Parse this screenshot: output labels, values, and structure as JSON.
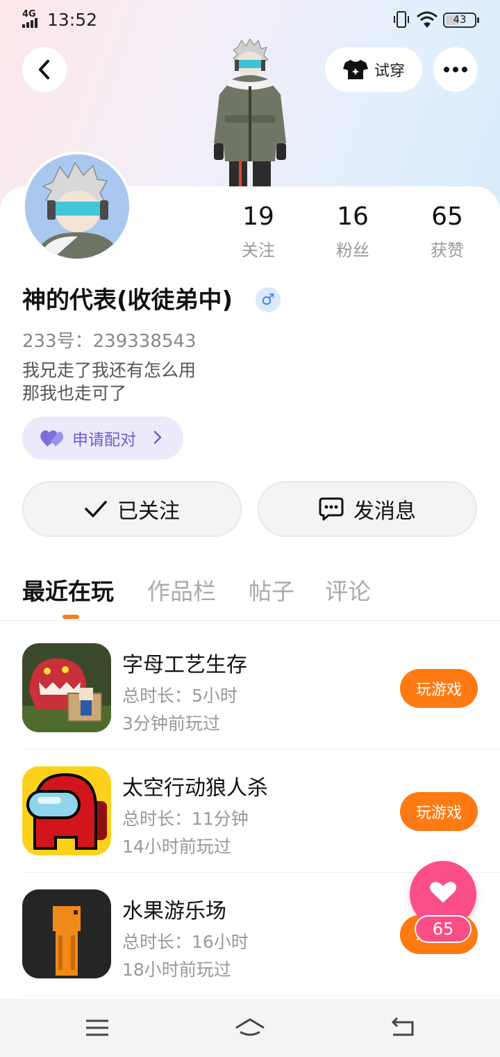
{
  "status_bar": {
    "network": "4G",
    "time": "13:52",
    "battery": "43"
  },
  "header": {
    "try_on_label": "试穿"
  },
  "profile": {
    "stats": [
      {
        "value": "19",
        "label": "关注"
      },
      {
        "value": "16",
        "label": "粉丝"
      },
      {
        "value": "65",
        "label": "获赞"
      }
    ],
    "name": "神的代表(收徒弟中)",
    "gender_symbol": "♂",
    "id_text": "233号：239338543",
    "bio_line1": "我兄走了我还有怎么用",
    "bio_line2": "那我也走可了",
    "pair_label": "申请配对"
  },
  "actions": {
    "followed_label": "已关注",
    "message_label": "发消息"
  },
  "tabs": [
    {
      "label": "最近在玩",
      "active": true
    },
    {
      "label": "作品栏",
      "active": false
    },
    {
      "label": "帖子",
      "active": false
    },
    {
      "label": "评论",
      "active": false
    }
  ],
  "games": [
    {
      "title": "字母工艺生存",
      "duration": "总时长：5小时",
      "last_played": "3分钟前玩过",
      "button": "玩游戏"
    },
    {
      "title": "太空行动狼人杀",
      "duration": "总时长：11分钟",
      "last_played": "14小时前玩过",
      "button": "玩游戏"
    },
    {
      "title": "水果游乐场",
      "duration": "总时长：16小时",
      "last_played": "18小时前玩过",
      "button": "玩游戏"
    }
  ],
  "like_fab": {
    "count": "65"
  },
  "colors": {
    "accent_orange": "#ff7a12",
    "like_pink": "#fa4f86",
    "pair_purple": "#6b5fd0"
  }
}
